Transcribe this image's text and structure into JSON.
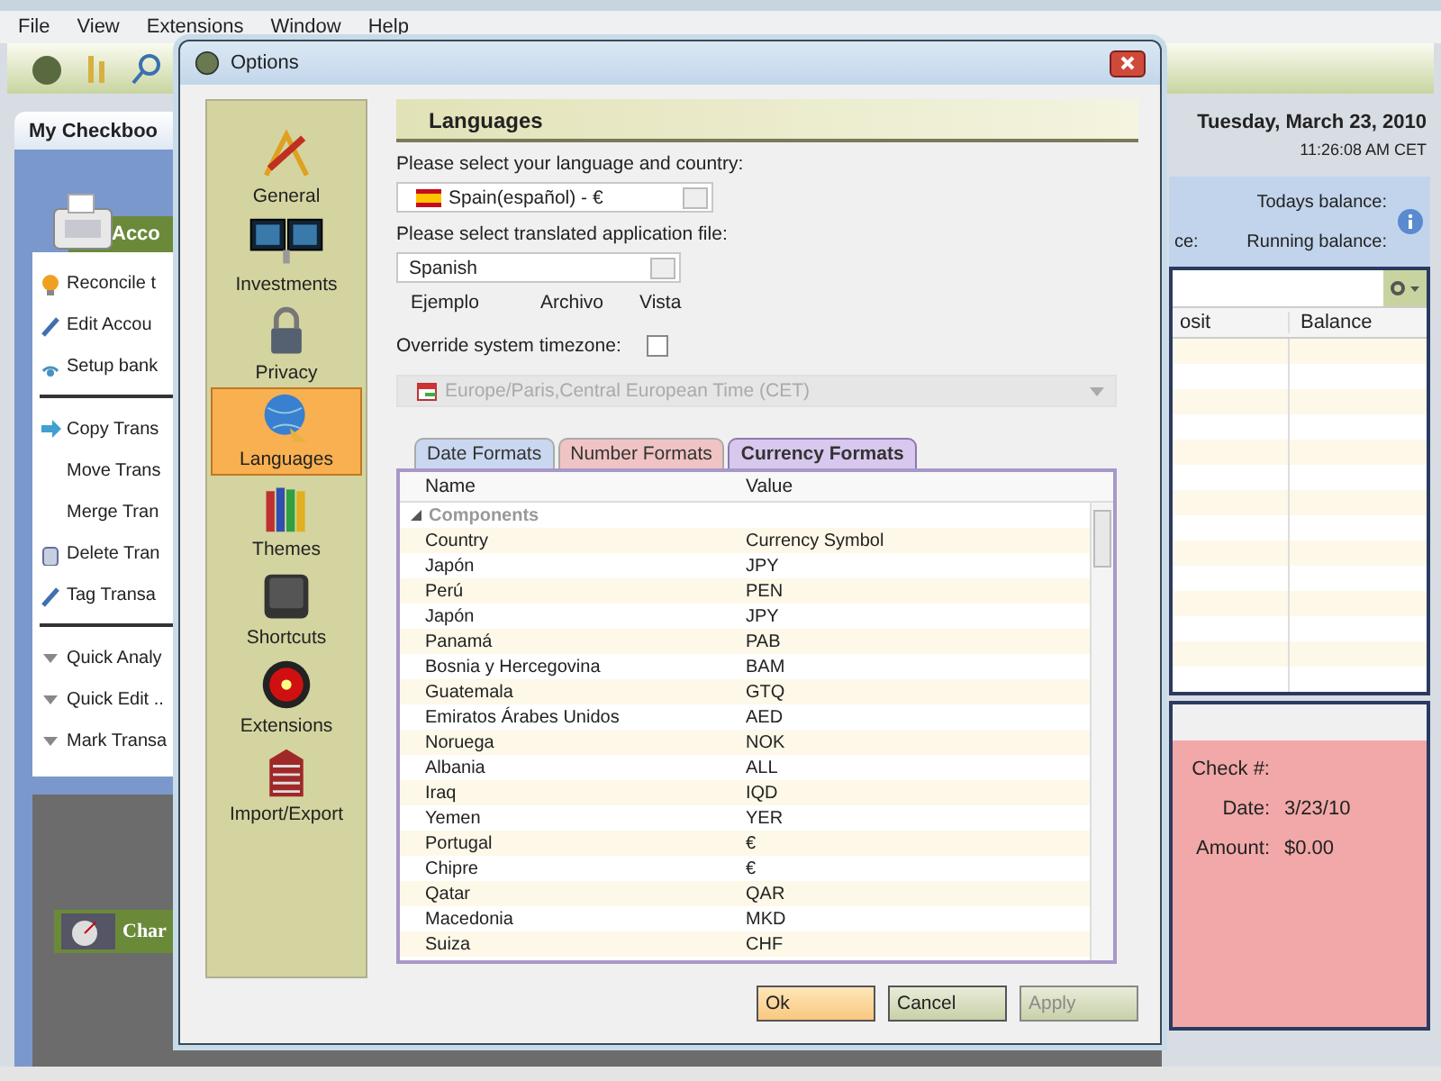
{
  "menu": [
    "File",
    "View",
    "Extensions",
    "Window",
    "Help"
  ],
  "main": {
    "tab": "My Checkboo",
    "panel_header": "Acco",
    "actions": [
      {
        "kind": "link",
        "label": "Reconcile t"
      },
      {
        "kind": "link",
        "label": "Edit Accou"
      },
      {
        "kind": "link",
        "label": "Setup bank"
      },
      {
        "kind": "divider"
      },
      {
        "kind": "link",
        "label": "Copy Trans"
      },
      {
        "kind": "link",
        "label": "Move Trans"
      },
      {
        "kind": "link",
        "label": "Merge Tran"
      },
      {
        "kind": "link",
        "label": "Delete Tran"
      },
      {
        "kind": "link",
        "label": "Tag Transa"
      },
      {
        "kind": "divider"
      },
      {
        "kind": "link",
        "label": "Quick Analy"
      },
      {
        "kind": "link",
        "label": "Quick Edit .."
      },
      {
        "kind": "link",
        "label": "Mark Transa"
      }
    ],
    "chart_label": "Char",
    "date": "Tuesday, March 23, 2010",
    "time": "11:26:08 AM CET",
    "balance_labels": [
      "Todays balance:",
      "Running balance:"
    ],
    "partial_label": "ce:",
    "grid_columns": [
      "osit",
      "Balance"
    ],
    "check_fields": [
      {
        "label": "Check #:"
      },
      {
        "label": "Date:",
        "value": "3/23/10"
      },
      {
        "label": "Amount:",
        "value": "$0.00"
      }
    ]
  },
  "dialog": {
    "title": "Options",
    "categories": [
      {
        "label": "General",
        "selected": false
      },
      {
        "label": "Investments",
        "selected": false
      },
      {
        "label": "Privacy",
        "selected": false
      },
      {
        "label": "Languages",
        "selected": true
      },
      {
        "label": "Themes",
        "selected": false
      },
      {
        "label": "Shortcuts",
        "selected": false
      },
      {
        "label": "Extensions",
        "selected": false
      },
      {
        "label": "Import/Export",
        "selected": false
      }
    ],
    "heading": "Languages",
    "language_label": "Please select your language and country:",
    "language_value": "Spain(español) - €",
    "file_label": "Please select translated application file:",
    "file_value": "Spanish",
    "file_columns": [
      "Ejemplo",
      "Archivo",
      "Vista"
    ],
    "timezone_label": "Override system timezone:",
    "timezone_override": false,
    "timezone_value": "Europe/Paris,Central European Time (CET)",
    "tabs": [
      {
        "label": "Date Formats",
        "selected": false,
        "color": "#c9d8f0"
      },
      {
        "label": "Number Formats",
        "selected": false,
        "color": "#f0c4c4"
      },
      {
        "label": "Currency Formats",
        "selected": true,
        "color": "#d8c8ee"
      }
    ],
    "table": {
      "columns": [
        "Name",
        "Value"
      ],
      "group": "Components",
      "rows": [
        [
          "Country",
          "Currency Symbol"
        ],
        [
          "Japón",
          "JPY"
        ],
        [
          "Perú",
          "PEN"
        ],
        [
          "Japón",
          "JPY"
        ],
        [
          "Panamá",
          "PAB"
        ],
        [
          "Bosnia y Hercegovina",
          "BAM"
        ],
        [
          "Guatemala",
          "GTQ"
        ],
        [
          "Emiratos Árabes Unidos",
          "AED"
        ],
        [
          "Noruega",
          "NOK"
        ],
        [
          "Albania",
          "ALL"
        ],
        [
          "Iraq",
          "IQD"
        ],
        [
          "Yemen",
          "YER"
        ],
        [
          "Portugal",
          "€"
        ],
        [
          "Chipre",
          "€"
        ],
        [
          "Qatar",
          "QAR"
        ],
        [
          "Macedonia",
          "MKD"
        ],
        [
          "Suiza",
          "CHF"
        ]
      ]
    },
    "buttons": [
      {
        "label": "Ok",
        "kind": "primary",
        "disabled": false
      },
      {
        "label": "Cancel",
        "kind": "normal",
        "disabled": false
      },
      {
        "label": "Apply",
        "kind": "normal",
        "disabled": true
      }
    ]
  }
}
